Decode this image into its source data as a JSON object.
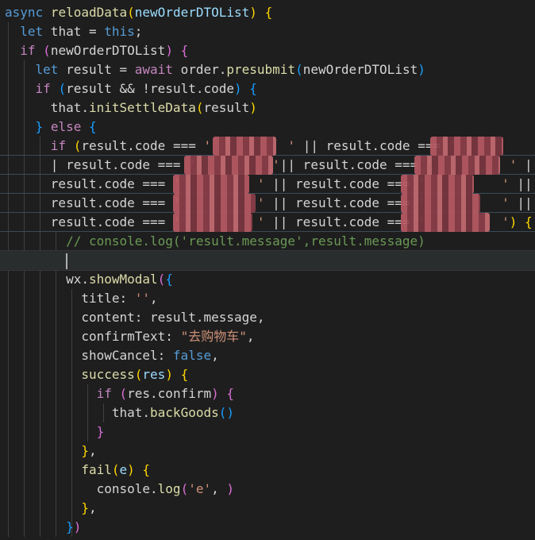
{
  "editor": {
    "theme": {
      "background": "#1e1e1e",
      "keyword": "#569cd6",
      "control": "#c586c0",
      "function": "#dcdcaa",
      "variable": "#9cdcfe",
      "string": "#ce9178",
      "comment": "#6a9955"
    },
    "lines": [
      [
        [
          "kw",
          "async"
        ],
        [
          "t",
          " "
        ],
        [
          "fn",
          "reloadData"
        ],
        [
          "b1",
          "("
        ],
        [
          "vr",
          "newOrderDTOList"
        ],
        [
          "b1",
          ")"
        ],
        [
          "t",
          " "
        ],
        [
          "b1",
          "{"
        ]
      ],
      [
        [
          "t",
          "  "
        ],
        [
          "kw",
          "let"
        ],
        [
          "t",
          " that = "
        ],
        [
          "kw",
          "this"
        ],
        [
          "t",
          ";"
        ]
      ],
      [
        [
          "t",
          "  "
        ],
        [
          "ctl",
          "if"
        ],
        [
          "t",
          " "
        ],
        [
          "b2",
          "("
        ],
        [
          "t",
          "newOrderDTOList"
        ],
        [
          "b2",
          ")"
        ],
        [
          "t",
          " "
        ],
        [
          "b2",
          "{"
        ]
      ],
      [
        [
          "t",
          "    "
        ],
        [
          "kw",
          "let"
        ],
        [
          "t",
          " result = "
        ],
        [
          "ctl",
          "await"
        ],
        [
          "t",
          " order."
        ],
        [
          "fn",
          "presubmit"
        ],
        [
          "b3",
          "("
        ],
        [
          "t",
          "newOrderDTOList"
        ],
        [
          "b3",
          ")"
        ]
      ],
      [
        [
          "t",
          "    "
        ],
        [
          "ctl",
          "if"
        ],
        [
          "t",
          " "
        ],
        [
          "b3",
          "("
        ],
        [
          "t",
          "result && !result.code"
        ],
        [
          "b3",
          ")"
        ],
        [
          "t",
          " "
        ],
        [
          "b3",
          "{"
        ]
      ],
      [
        [
          "t",
          "      that."
        ],
        [
          "fn",
          "initSettleData"
        ],
        [
          "b1",
          "("
        ],
        [
          "t",
          "result"
        ],
        [
          "b1",
          ")"
        ]
      ],
      [
        [
          "t",
          "    "
        ],
        [
          "b3",
          "}"
        ],
        [
          "t",
          " "
        ],
        [
          "ctl",
          "else"
        ],
        [
          "t",
          " "
        ],
        [
          "b3",
          "{"
        ]
      ],
      [
        [
          "t",
          "      "
        ],
        [
          "ctl",
          "if"
        ],
        [
          "t",
          " "
        ],
        [
          "b1",
          "("
        ],
        [
          "t",
          "result.code === "
        ],
        [
          "str",
          "'          '"
        ],
        [
          "t",
          " || result.code === "
        ],
        [
          "str",
          "'          '"
        ],
        [
          "t",
          " |"
        ]
      ],
      [
        [
          "t",
          "      | result.code === "
        ],
        [
          "str",
          "'          '"
        ],
        [
          "t",
          "|| result.code === "
        ],
        [
          "str",
          "'          '"
        ],
        [
          "t",
          " ||"
        ]
      ],
      [
        [
          "t",
          "      result.code === "
        ],
        [
          "str",
          "'          '"
        ],
        [
          "t",
          " || result.code === "
        ],
        [
          "str",
          "'          '"
        ],
        [
          "t",
          " ||"
        ]
      ],
      [
        [
          "t",
          "      result.code === "
        ],
        [
          "str",
          "'          '"
        ],
        [
          "t",
          " || result.code === "
        ],
        [
          "str",
          "'          '"
        ],
        [
          "t",
          " ||"
        ]
      ],
      [
        [
          "t",
          "      result.code === "
        ],
        [
          "str",
          "'          '"
        ],
        [
          "t",
          " || result.code === "
        ],
        [
          "str",
          "'          '"
        ],
        [
          "b1",
          ")"
        ],
        [
          "t",
          " "
        ],
        [
          "b1",
          "{"
        ]
      ],
      [
        [
          "t",
          "        "
        ],
        [
          "cm",
          "// console.log('result.message',result.message)"
        ]
      ],
      [
        [
          "t",
          "        "
        ]
      ],
      [
        [
          "t",
          "        wx."
        ],
        [
          "fn",
          "showModal"
        ],
        [
          "b2",
          "("
        ],
        [
          "b3",
          "{"
        ]
      ],
      [
        [
          "t",
          "          title: "
        ],
        [
          "str",
          "''"
        ],
        [
          "t",
          ","
        ]
      ],
      [
        [
          "t",
          "          content: result.message,"
        ]
      ],
      [
        [
          "t",
          "          confirmText: "
        ],
        [
          "str",
          "\"去购物车\""
        ],
        [
          "t",
          ","
        ]
      ],
      [
        [
          "t",
          "          showCancel: "
        ],
        [
          "kw",
          "false"
        ],
        [
          "t",
          ","
        ]
      ],
      [
        [
          "t",
          "          "
        ],
        [
          "fn",
          "success"
        ],
        [
          "b1",
          "("
        ],
        [
          "vr",
          "res"
        ],
        [
          "b1",
          ")"
        ],
        [
          "t",
          " "
        ],
        [
          "b1",
          "{"
        ]
      ],
      [
        [
          "t",
          "            "
        ],
        [
          "ctl",
          "if"
        ],
        [
          "t",
          " "
        ],
        [
          "b2",
          "("
        ],
        [
          "t",
          "res.confirm"
        ],
        [
          "b2",
          ")"
        ],
        [
          "t",
          " "
        ],
        [
          "b2",
          "{"
        ]
      ],
      [
        [
          "t",
          "              that."
        ],
        [
          "fn",
          "backGoods"
        ],
        [
          "b3",
          "("
        ],
        [
          "b3",
          ")"
        ]
      ],
      [
        [
          "t",
          "            "
        ],
        [
          "b2",
          "}"
        ]
      ],
      [
        [
          "t",
          "          "
        ],
        [
          "b1",
          "}"
        ],
        [
          "t",
          ","
        ]
      ],
      [
        [
          "t",
          "          "
        ],
        [
          "fn",
          "fail"
        ],
        [
          "b1",
          "("
        ],
        [
          "vr",
          "e"
        ],
        [
          "b1",
          ")"
        ],
        [
          "t",
          " "
        ],
        [
          "b1",
          "{"
        ]
      ],
      [
        [
          "t",
          "            console."
        ],
        [
          "fn",
          "log"
        ],
        [
          "b2",
          "("
        ],
        [
          "str",
          "'e'"
        ],
        [
          "t",
          ", "
        ],
        [
          "b2",
          ")"
        ]
      ],
      [
        [
          "t",
          "          "
        ],
        [
          "b1",
          "}"
        ],
        [
          "t",
          ","
        ]
      ],
      [
        [
          "t",
          "        "
        ],
        [
          "b3",
          "}"
        ],
        [
          "b2",
          ")"
        ]
      ]
    ]
  }
}
